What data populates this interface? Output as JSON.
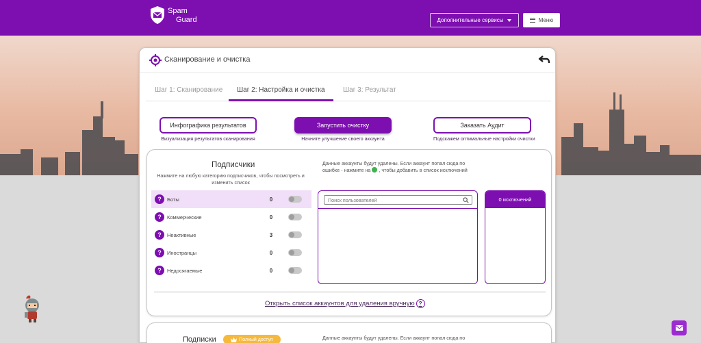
{
  "brand": {
    "name_line1": "Spam",
    "name_line2": "Guard"
  },
  "header": {
    "services_label": "Дополнительные сервисы",
    "menu_label": "Меню"
  },
  "card": {
    "title": "Сканирование и очистка"
  },
  "tabs": [
    {
      "label": "Шаг 1: Сканирование",
      "active": false
    },
    {
      "label": "Шаг 2: Настройка и очистка",
      "active": true
    },
    {
      "label": "Шаг 3: Результат",
      "active": false
    }
  ],
  "actions": {
    "infographic": {
      "label": "Инфографика результатов",
      "caption": "Визуализация результатов сканирования"
    },
    "start": {
      "label": "Запустить очистку",
      "caption": "Начните улучшение своего аккаунта"
    },
    "audit": {
      "label": "Заказать Аудит",
      "caption": "Подскажем оптимальные настройки очистки"
    }
  },
  "subscribers": {
    "title": "Подписчики",
    "description": "Нажмите на любую категорию подписчиков, чтобы посмотреть и изменить список",
    "delete_note_part1": "Данные аккаунты будут удалены. Если аккаунт попал сюда по ошибке - нажмите на",
    "delete_note_part2": ", чтобы добавить в список исключений",
    "categories": [
      {
        "label": "Боты",
        "count": "0"
      },
      {
        "label": "Коммерческие",
        "count": "0"
      },
      {
        "label": "Неактивные",
        "count": "3"
      },
      {
        "label": "Иностранцы",
        "count": "0"
      },
      {
        "label": "Недосягаемые",
        "count": "0"
      }
    ],
    "search_placeholder": "Поиск пользователей",
    "exclusions_label": "0 исключений",
    "manual_link": "Открыть список аккаунтов для удаления вручную",
    "help_glyph": "?"
  },
  "subscriptions": {
    "title": "Подписки",
    "badge": "Полный доступ",
    "note": "Данные аккаунты будут удалены. Если аккаунт попал сюда по"
  },
  "colors": {
    "brand": "#7d0fb0",
    "badge": "#f6b93b",
    "ok": "#3fb34f"
  },
  "icons": [
    "shield-icon",
    "caret-down-icon",
    "hamburger-icon",
    "target-icon",
    "back-arrow-icon",
    "question-icon",
    "check-icon",
    "search-icon",
    "crown-icon",
    "mail-icon"
  ]
}
